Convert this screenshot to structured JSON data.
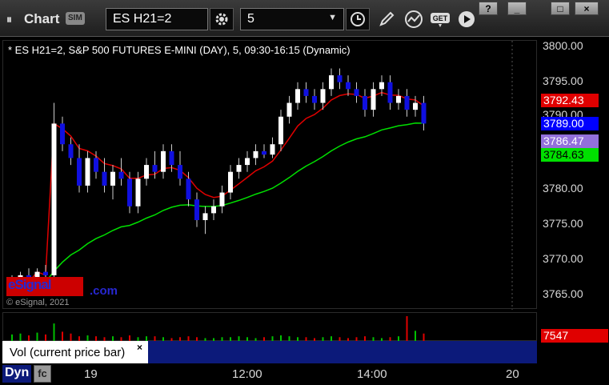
{
  "titlebar": {
    "grip": "⏸",
    "title": "Chart",
    "sim_badge": "SIM",
    "symbol": "ES H21=2",
    "interval": "5",
    "icons": [
      "settings-gear-icon",
      "clock-icon",
      "pencil-icon",
      "indicator-icon",
      "get-icon",
      "play-icon"
    ],
    "window_buttons": [
      "?",
      "_",
      "□",
      "×"
    ]
  },
  "chart": {
    "description": "* ES H21=2, S&P 500 FUTURES E-MINI (DAY), 5, 09:30-16:15 (Dynamic)",
    "logo_text": "eSignal",
    "logo_com": ".com",
    "copyright": "© eSignal, 2021",
    "y_ticks": [
      "3800.00",
      "3795.00",
      "3790.00",
      "3780.00",
      "3775.00",
      "3770.00",
      "3765.00"
    ],
    "price_labels": {
      "red_line": "3792.43",
      "last": "3789.00",
      "purple_line": "3786.47",
      "green_line": "3784.63"
    },
    "colors": {
      "red_line": "#e00000",
      "last": "#0000ff",
      "purple_line": "#9370db",
      "green_line": "#00e000"
    },
    "time_labels": [
      "19",
      "12:00",
      "14:00",
      "20"
    ]
  },
  "chart_data": {
    "type": "candlestick",
    "y_axis": {
      "min": 3762,
      "max": 3801
    },
    "candles": [
      [
        3766,
        3767,
        3765,
        3766
      ],
      [
        3766,
        3767.5,
        3765,
        3767
      ],
      [
        3767,
        3768,
        3765.5,
        3766
      ],
      [
        3766,
        3768,
        3765,
        3767.5
      ],
      [
        3767.5,
        3768.5,
        3766,
        3767
      ],
      [
        3767,
        3792,
        3766,
        3789
      ],
      [
        3789,
        3790,
        3785,
        3786
      ],
      [
        3786,
        3787,
        3783,
        3784
      ],
      [
        3784,
        3786,
        3779,
        3780
      ],
      [
        3780,
        3785,
        3779,
        3784
      ],
      [
        3784,
        3785,
        3781,
        3782
      ],
      [
        3782,
        3784,
        3779,
        3780
      ],
      [
        3780,
        3783,
        3778,
        3782
      ],
      [
        3782,
        3784,
        3780,
        3781
      ],
      [
        3781,
        3782,
        3776,
        3777
      ],
      [
        3777,
        3782,
        3776,
        3781
      ],
      [
        3781,
        3784,
        3780,
        3783
      ],
      [
        3783,
        3785,
        3781,
        3782
      ],
      [
        3782,
        3786,
        3781,
        3785
      ],
      [
        3785,
        3786,
        3782,
        3783
      ],
      [
        3783,
        3785,
        3780,
        3781
      ],
      [
        3781,
        3782,
        3777,
        3778
      ],
      [
        3778,
        3779,
        3774,
        3775
      ],
      [
        3775,
        3777,
        3773,
        3776
      ],
      [
        3776,
        3778,
        3775,
        3777
      ],
      [
        3777,
        3780,
        3776,
        3779
      ],
      [
        3779,
        3783,
        3778,
        3782
      ],
      [
        3782,
        3784,
        3781,
        3783
      ],
      [
        3783,
        3785,
        3782,
        3784
      ],
      [
        3784,
        3786,
        3783,
        3785
      ],
      [
        3785,
        3786,
        3784,
        3784.5
      ],
      [
        3784.5,
        3787,
        3784,
        3786
      ],
      [
        3786,
        3791,
        3785,
        3790
      ],
      [
        3790,
        3793,
        3789,
        3792
      ],
      [
        3792,
        3795,
        3791,
        3794
      ],
      [
        3794,
        3795,
        3792,
        3793
      ],
      [
        3793,
        3794,
        3791,
        3792
      ],
      [
        3792,
        3795,
        3791,
        3794
      ],
      [
        3794,
        3797,
        3793,
        3796
      ],
      [
        3796,
        3797,
        3794,
        3795
      ],
      [
        3795,
        3796,
        3793,
        3794
      ],
      [
        3794,
        3795,
        3792,
        3793
      ],
      [
        3793,
        3794,
        3790,
        3791
      ],
      [
        3791,
        3795,
        3790,
        3794
      ],
      [
        3794,
        3796,
        3793,
        3795
      ],
      [
        3795,
        3796,
        3791,
        3792
      ],
      [
        3792,
        3794,
        3791,
        3793
      ],
      [
        3793,
        3794,
        3790,
        3791
      ],
      [
        3791,
        3793,
        3790,
        3792
      ],
      [
        3792,
        3793,
        3788,
        3789
      ]
    ],
    "volume": [
      8,
      9,
      7,
      10,
      8,
      20,
      11,
      9,
      6,
      7,
      6,
      5,
      6,
      5,
      7,
      5,
      6,
      6,
      5,
      4,
      5,
      6,
      5,
      4,
      4,
      5,
      5,
      6,
      5,
      4,
      5,
      6,
      7,
      6,
      5,
      5,
      4,
      5,
      6,
      5,
      4,
      5,
      6,
      5,
      4,
      5,
      6,
      28,
      12,
      9
    ]
  },
  "volume_pane": {
    "label": "Vol (current price bar)",
    "close": "×",
    "value": "7547"
  },
  "footer": {
    "dyn_label": "Dyn",
    "fc_icon": "fc"
  }
}
